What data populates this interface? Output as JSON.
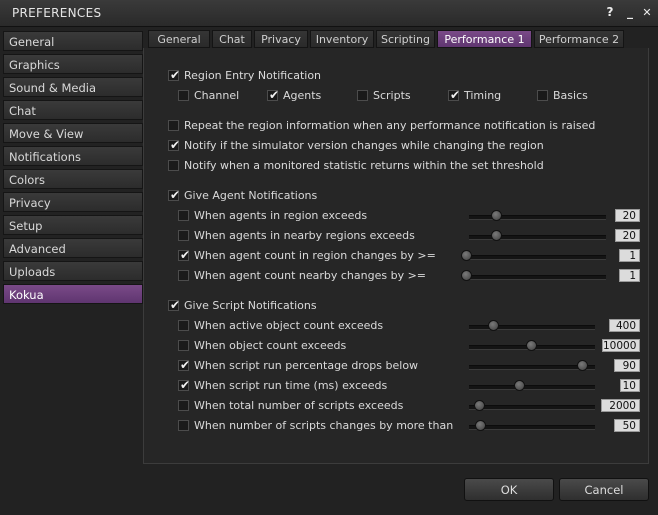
{
  "window": {
    "title": "PREFERENCES",
    "help_glyph": "?",
    "minimize_glyph": "_",
    "close_glyph": "✕"
  },
  "sidebar": {
    "items": [
      {
        "label": "General"
      },
      {
        "label": "Graphics"
      },
      {
        "label": "Sound & Media"
      },
      {
        "label": "Chat"
      },
      {
        "label": "Move & View"
      },
      {
        "label": "Notifications"
      },
      {
        "label": "Colors"
      },
      {
        "label": "Privacy"
      },
      {
        "label": "Setup"
      },
      {
        "label": "Advanced"
      },
      {
        "label": "Uploads"
      },
      {
        "label": "Kokua",
        "active": true
      }
    ]
  },
  "tabs": [
    {
      "label": "General"
    },
    {
      "label": "Chat"
    },
    {
      "label": "Privacy"
    },
    {
      "label": "Inventory"
    },
    {
      "label": "Scripting"
    },
    {
      "label": "Performance 1",
      "active": true
    },
    {
      "label": "Performance 2"
    }
  ],
  "region": {
    "main": {
      "label": "Region Entry Notification",
      "checked": true
    },
    "sub": [
      {
        "label": "Channel",
        "checked": false
      },
      {
        "label": "Agents",
        "checked": true
      },
      {
        "label": "Scripts",
        "checked": false
      },
      {
        "label": "Timing",
        "checked": true
      },
      {
        "label": "Basics",
        "checked": false
      }
    ]
  },
  "misc": [
    {
      "label": "Repeat the region information when any performance notification is raised",
      "checked": false
    },
    {
      "label": "Notify if the simulator version changes while changing the region",
      "checked": true
    },
    {
      "label": "Notify when a monitored statistic returns within the set threshold",
      "checked": false
    }
  ],
  "agent": {
    "main": {
      "label": "Give Agent Notifications",
      "checked": true
    },
    "rows": [
      {
        "label": "When agents in region exceeds",
        "checked": false,
        "value": "20",
        "level": 0.2
      },
      {
        "label": "When agents in nearby regions exceeds",
        "checked": false,
        "value": "20",
        "level": 0.2
      },
      {
        "label": "When agent count in region changes by >=",
        "checked": true,
        "value": "1",
        "level": 0.0
      },
      {
        "label": "When agent count nearby changes by >=",
        "checked": false,
        "value": "1",
        "level": 0.0
      }
    ]
  },
  "script": {
    "main": {
      "label": "Give Script Notifications",
      "checked": true
    },
    "rows": [
      {
        "label": "When active object count exceeds",
        "checked": false,
        "value": "400",
        "level": 0.19
      },
      {
        "label": "When object count exceeds",
        "checked": false,
        "value": "10000",
        "level": 0.49
      },
      {
        "label": "When script run percentage drops below",
        "checked": true,
        "value": "90",
        "level": 0.9
      },
      {
        "label": "When script run time (ms) exceeds",
        "checked": true,
        "value": "10",
        "level": 0.4
      },
      {
        "label": "When total number of scripts exceeds",
        "checked": false,
        "value": "2000",
        "level": 0.08
      },
      {
        "label": "When number of scripts changes by more than",
        "checked": false,
        "value": "50",
        "level": 0.09
      }
    ]
  },
  "buttons": {
    "ok": "OK",
    "cancel": "Cancel"
  },
  "colors": {
    "accent": "#6b3f7c",
    "panel": "#262626",
    "text": "#dadada"
  }
}
